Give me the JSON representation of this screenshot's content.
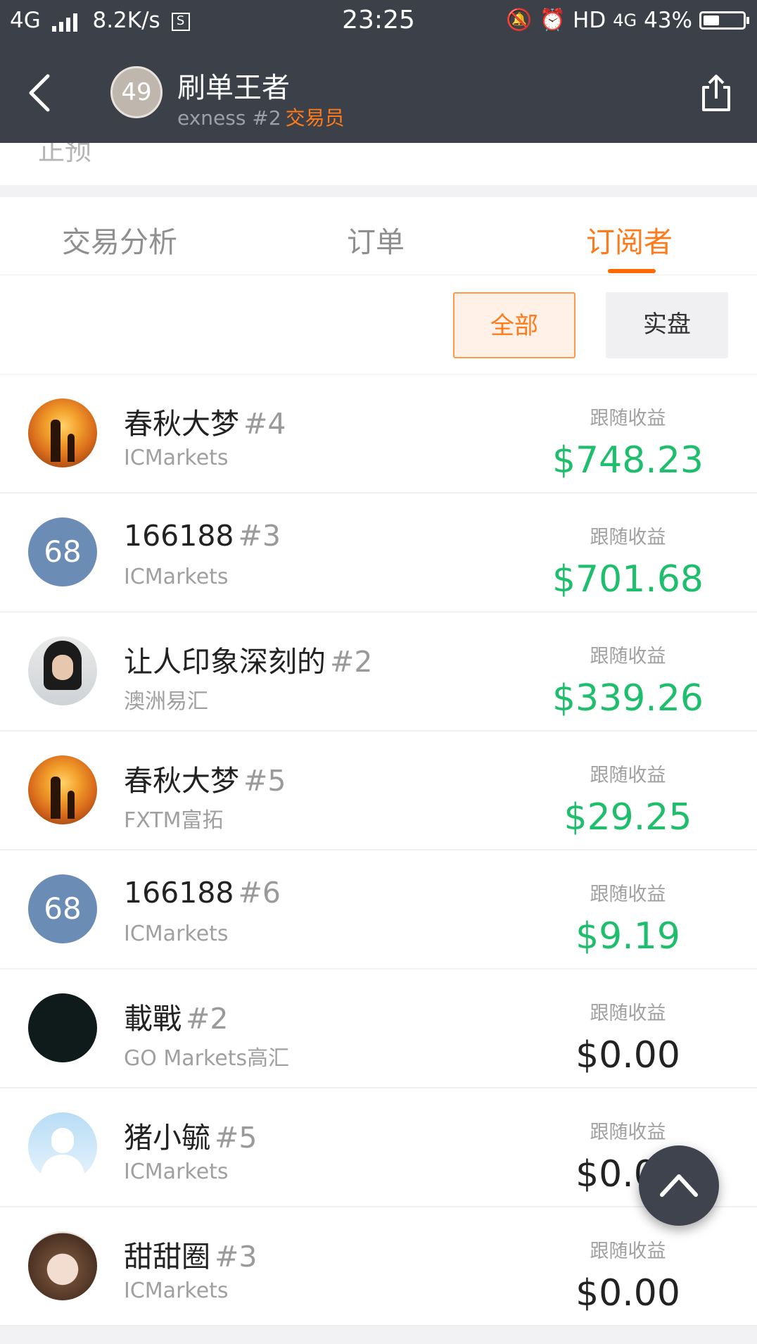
{
  "status_bar": {
    "network": "4G",
    "speed": "8.2K/s",
    "time": "23:25",
    "hd": "HD",
    "network2": "4G",
    "battery": "43%"
  },
  "header": {
    "avatar_text": "49",
    "name": "刷单王者",
    "sub": "exness #2",
    "role": "交易员"
  },
  "clipped_text": "正预",
  "tabs": [
    {
      "label": "交易分析"
    },
    {
      "label": "订单"
    },
    {
      "label": "订阅者"
    }
  ],
  "filters": {
    "all": "全部",
    "real": "实盘"
  },
  "follower_label": "跟随收益",
  "followers": [
    {
      "name": "春秋大梦",
      "tag": "#4",
      "broker": "ICMarkets",
      "amount": "$748.23",
      "avatar": "sunset"
    },
    {
      "name": "166188",
      "tag": "#3",
      "broker": "ICMarkets",
      "amount": "$701.68",
      "avatar": "68"
    },
    {
      "name": "让人印象深刻的",
      "tag": "#2",
      "broker": "澳洲易汇",
      "amount": "$339.26",
      "avatar": "portrait"
    },
    {
      "name": "春秋大梦",
      "tag": "#5",
      "broker": "FXTM富拓",
      "amount": "$29.25",
      "avatar": "sunset"
    },
    {
      "name": "166188",
      "tag": "#6",
      "broker": "ICMarkets",
      "amount": "$9.19",
      "avatar": "68"
    },
    {
      "name": "載戰",
      "tag": "#2",
      "broker": "GO Markets高汇",
      "amount": "$0.00",
      "avatar": "dark"
    },
    {
      "name": "猪小毓",
      "tag": "#5",
      "broker": "ICMarkets",
      "amount": "$0.00",
      "avatar": "default"
    },
    {
      "name": "甜甜圈",
      "tag": "#3",
      "broker": "ICMarkets",
      "amount": "$0.00",
      "avatar": "anime"
    }
  ],
  "colors": {
    "header_bg": "#3b4049",
    "accent": "#ff7a1a",
    "positive": "#1fbe6c"
  }
}
